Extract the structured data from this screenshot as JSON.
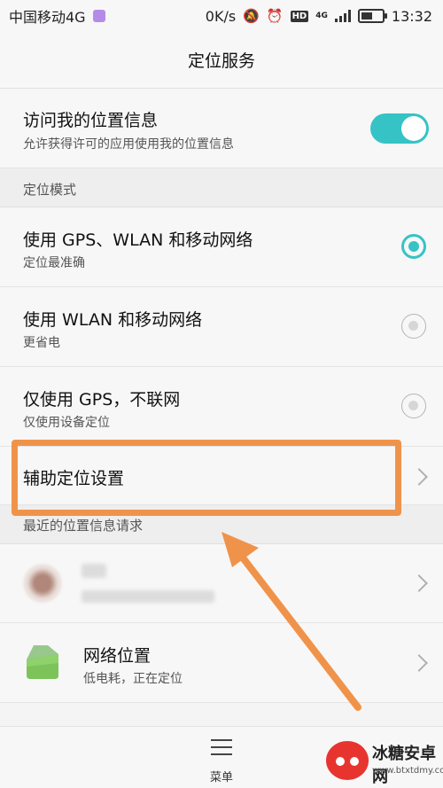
{
  "status_bar": {
    "carrier": "中国移动4G",
    "speed": "0K/s",
    "net_badge": "HD",
    "net_type": "4G",
    "time": "13:32"
  },
  "title": "定位服务",
  "access_location": {
    "title": "访问我的位置信息",
    "subtitle": "允许获得许可的应用使用我的位置信息",
    "enabled": true
  },
  "mode_section": {
    "header": "定位模式",
    "options": [
      {
        "title": "使用 GPS、WLAN 和移动网络",
        "subtitle": "定位最准确",
        "selected": true
      },
      {
        "title": "使用 WLAN 和移动网络",
        "subtitle": "更省电",
        "selected": false
      },
      {
        "title": "仅使用 GPS，不联网",
        "subtitle": "仅使用设备定位",
        "selected": false
      }
    ]
  },
  "assist_setting": {
    "title": "辅助定位设置"
  },
  "recent_section": {
    "header": "最近的位置信息请求",
    "items": [
      {
        "title": "",
        "subtitle": "",
        "icon": "blurred-app-icon"
      },
      {
        "title": "网络位置",
        "subtitle": "低电耗，正在定位",
        "icon": "android-icon"
      }
    ]
  },
  "bottom_bar": {
    "menu_label": "菜单"
  },
  "watermark": {
    "title": "冰糖安卓网",
    "url": "www.btxtdmy.com"
  },
  "colors": {
    "accent": "#35c3c6",
    "highlight": "#f0934a"
  }
}
